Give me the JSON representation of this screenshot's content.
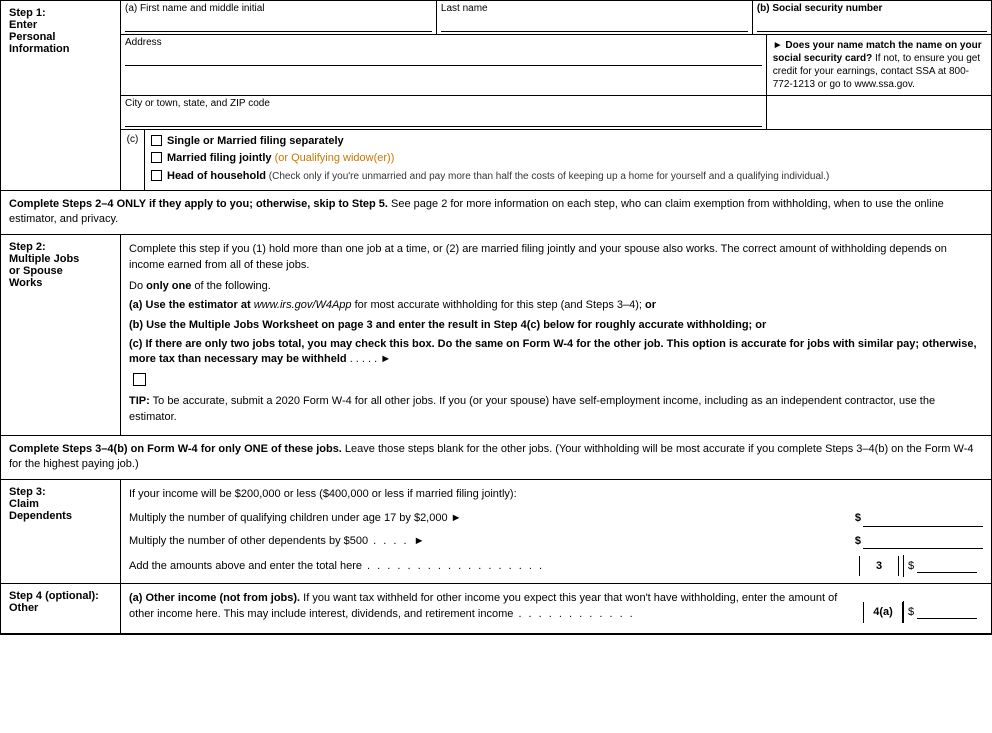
{
  "form": {
    "step1": {
      "label_step": "Step 1:",
      "label_enter": "Enter",
      "label_personal": "Personal",
      "label_information": "Information",
      "field_a_label": "(a) First name and middle initial",
      "field_last_name_label": "Last name",
      "field_ssn_label": "(b) Social security number",
      "field_address_label": "Address",
      "ssn_note_line1": "► Does your name match the",
      "ssn_note_line2": "name on your social security",
      "ssn_note_line3": "card?",
      "ssn_note_line4": " If not, to ensure you get credit for your earnings, contact SSA at 800-772-1213 or go to ",
      "ssn_note_link": "www.ssa.gov.",
      "field_city_label": "City or town, state, and ZIP code",
      "filing_c_label": "(c)",
      "option1_text": "Single or Married filing separately",
      "option2_bold": "Married filing jointly",
      "option2_orange": " (or Qualifying widow(er))",
      "option3_bold": "Head of household",
      "option3_small": " (Check only if you're unmarried and pay more than half the costs of keeping up a home for yourself and a qualifying individual.)"
    },
    "complete_notice": {
      "text1": "Complete Steps 2–4 ONLY if they apply to you; otherwise, skip to Step 5.",
      "text2": " See page 2 for more information on each step, who can claim exemption from withholding, when to use the online estimator, and privacy."
    },
    "step2": {
      "label_step": "Step 2:",
      "label_multiple": "Multiple Jobs",
      "label_or": "or Spouse",
      "label_works": "Works",
      "intro": "Complete this step if you (1) hold more than one job at a time, or (2) are married filing jointly and your spouse also works. The correct amount of withholding depends on income earned from all of these jobs.",
      "do_one": "Do ",
      "do_one_bold": "only one",
      "do_one_rest": " of the following.",
      "option_a": "(a) Use the estimator at ",
      "option_a_italic": "www.irs.gov/W4App",
      "option_a_rest": " for most accurate withholding for this step (and Steps 3–4); ",
      "option_a_or": "or",
      "option_b": "(b) Use the Multiple Jobs Worksheet on page 3 and enter the result in Step 4(c) below for roughly accurate withholding; ",
      "option_b_or": "or",
      "option_c": "(c) If there are only two jobs total, you may check this box. Do the same on Form W-4 for the other job. This option is accurate for jobs with similar pay; otherwise, more tax than necessary may be withheld",
      "option_c_dots": " . . . . . ►",
      "tip_label": "TIP:",
      "tip_text": " To be accurate, submit a 2020 Form W-4 for all other jobs. If you (or your spouse) have self-employment income, including as an independent contractor, use the estimator."
    },
    "complete34_notice": {
      "text1": "Complete Steps 3–4(b) on Form W-4 for only ONE of these jobs.",
      "text2": " Leave those steps blank for the other jobs. (Your withholding will be most accurate if you complete Steps 3–4(b) on the Form W-4 for the highest paying job.)"
    },
    "step3": {
      "label_step": "Step 3:",
      "label_claim": "Claim",
      "label_dependents": "Dependents",
      "intro": "If your income will be $200,000 or less ($400,000 or less if married filing jointly):",
      "children_text": "Multiply the number of qualifying children under age 17 by $2,000 ►",
      "children_prefix": "$ ",
      "other_text": "Multiply the number of other dependents by $500",
      "other_dots": " . . . . ►",
      "other_prefix": "$ ",
      "add_text": "Add the amounts above and enter the total here",
      "add_dots": " . . . . . . . . . . . . . . . . . .",
      "line_num": "3",
      "dollar_sign": "$"
    },
    "step4": {
      "label_step": "Step 4",
      "label_optional": "(optional):",
      "label_other": "Other",
      "a_bold": "(a) Other income (not from jobs).",
      "a_text": " If you want tax withheld for other income you expect this year that won't have withholding, enter the amount of other income here. This may include interest, dividends, and retirement income",
      "a_dots": " . . . . . . . . . . . .",
      "line_num": "4(a)",
      "dollar_sign": "$"
    }
  }
}
